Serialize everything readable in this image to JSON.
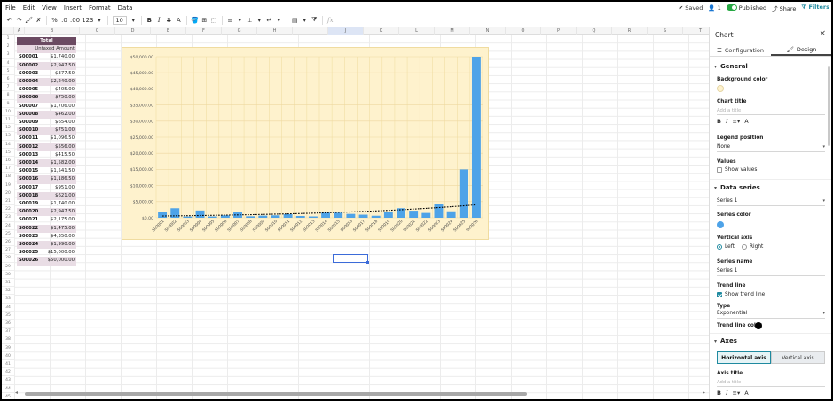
{
  "menu": [
    "File",
    "Edit",
    "View",
    "Insert",
    "Format",
    "Data"
  ],
  "status": {
    "saved": "Saved",
    "users": "1",
    "published": "Published",
    "share": "Share",
    "filters": "Filters"
  },
  "toolbar": {
    "percent": "%",
    "dec_decrease": ".0",
    "dec_increase": ".00",
    "num_format": "123",
    "font_size": "10",
    "bold": "B",
    "italic": "I",
    "strike": "S",
    "text_color": "A",
    "fx": "fx"
  },
  "columns": [
    "A",
    "B",
    "C",
    "D",
    "E",
    "F",
    "G",
    "H",
    "I",
    "J",
    "K",
    "L",
    "M",
    "N",
    "O",
    "P",
    "Q",
    "R",
    "S",
    "T"
  ],
  "selected_column": "J",
  "rows": [
    "1",
    "2",
    "3",
    "4",
    "5",
    "6",
    "7",
    "8",
    "9",
    "10",
    "11",
    "12",
    "13",
    "14",
    "15",
    "16",
    "17",
    "18",
    "19",
    "20",
    "21",
    "22",
    "23",
    "24",
    "25",
    "26",
    "27",
    "28",
    "29",
    "30",
    "31",
    "32",
    "33",
    "34",
    "35",
    "36",
    "37",
    "38",
    "39",
    "40",
    "41",
    "42",
    "43",
    "44",
    "45"
  ],
  "table": {
    "header_total": "Total",
    "header_amount": "Untaxed Amount",
    "rows": [
      {
        "id": "S00001",
        "amount": "$1,740.00"
      },
      {
        "id": "S00002",
        "amount": "$2,947.50"
      },
      {
        "id": "S00003",
        "amount": "$377.50"
      },
      {
        "id": "S00004",
        "amount": "$2,240.00"
      },
      {
        "id": "S00005",
        "amount": "$405.00"
      },
      {
        "id": "S00006",
        "amount": "$750.00"
      },
      {
        "id": "S00007",
        "amount": "$1,706.00"
      },
      {
        "id": "S00008",
        "amount": "$462.00"
      },
      {
        "id": "S00009",
        "amount": "$654.00"
      },
      {
        "id": "S00010",
        "amount": "$751.00"
      },
      {
        "id": "S00011",
        "amount": "$1,096.50"
      },
      {
        "id": "S00012",
        "amount": "$556.00"
      },
      {
        "id": "S00013",
        "amount": "$415.50"
      },
      {
        "id": "S00014",
        "amount": "$1,582.00"
      },
      {
        "id": "S00015",
        "amount": "$1,541.50"
      },
      {
        "id": "S00016",
        "amount": "$1,186.50"
      },
      {
        "id": "S00017",
        "amount": "$951.00"
      },
      {
        "id": "S00018",
        "amount": "$621.00"
      },
      {
        "id": "S00019",
        "amount": "$1,740.00"
      },
      {
        "id": "S00020",
        "amount": "$2,947.50"
      },
      {
        "id": "S00021",
        "amount": "$2,175.00"
      },
      {
        "id": "S00022",
        "amount": "$1,475.00"
      },
      {
        "id": "S00023",
        "amount": "$4,350.00"
      },
      {
        "id": "S00024",
        "amount": "$1,990.00"
      },
      {
        "id": "S00025",
        "amount": "$15,000.00"
      },
      {
        "id": "S00026",
        "amount": "$50,000.00"
      }
    ]
  },
  "chart_data": {
    "type": "bar",
    "categories": [
      "S00001",
      "S00002",
      "S00003",
      "S00004",
      "S00005",
      "S00006",
      "S00007",
      "S00008",
      "S00009",
      "S00010",
      "S00011",
      "S00012",
      "S00013",
      "S00014",
      "S00015",
      "S00016",
      "S00017",
      "S00018",
      "S00019",
      "S00020",
      "S00021",
      "S00022",
      "S00023",
      "S00024",
      "S00025",
      "S00026"
    ],
    "series": [
      {
        "values": [
          1740,
          2947.5,
          377.5,
          2240,
          405,
          750,
          1706,
          462,
          654,
          751,
          1096.5,
          556,
          415.5,
          1582,
          1541.5,
          1186.5,
          951,
          621,
          1740,
          2947.5,
          2175,
          1475,
          4350,
          1990,
          15000,
          50000
        ],
        "color": "#4ea3e8"
      }
    ],
    "yticks": [
      "$0.00",
      "$5,000.00",
      "$10,000.00",
      "$15,000.00",
      "$20,000.00",
      "$25,000.00",
      "$30,000.00",
      "$35,000.00",
      "$40,000.00",
      "$45,000.00",
      "$50,000.00"
    ],
    "ylim": [
      0,
      50000
    ],
    "trend_line": "exponential",
    "trend_color": "#000000",
    "background": "#fef2cd",
    "grid": true,
    "legend": "none"
  },
  "panel": {
    "title": "Chart",
    "tab_config": "Configuration",
    "tab_design": "Design",
    "section_general": "General",
    "bg_color_label": "Background color",
    "chart_title_label": "Chart title",
    "title_placeholder": "Add a title",
    "legend_label": "Legend position",
    "legend_value": "None",
    "values_label": "Values",
    "show_values": "Show values",
    "section_series": "Data series",
    "series_select": "Series 1",
    "series_color_label": "Series color",
    "series_color": "#4ea3e8",
    "vaxis_label": "Vertical axis",
    "vaxis_left": "Left",
    "vaxis_right": "Right",
    "series_name_label": "Series name",
    "series_name_value": "Series 1",
    "trend_label": "Trend line",
    "show_trend": "Show trend line",
    "type_label": "Type",
    "type_value": "Exponential",
    "trend_color_label": "Trend line color",
    "section_axes": "Axes",
    "haxis_btn": "Horizontal axis",
    "vaxis_btn": "Vertical axis",
    "axis_title_label": "Axis title",
    "axis_title_placeholder": "Add a title"
  }
}
